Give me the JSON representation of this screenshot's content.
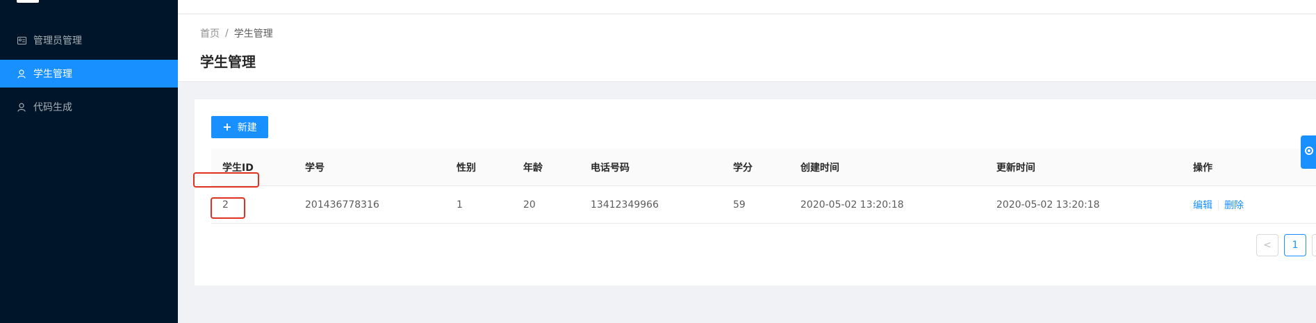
{
  "sidebar": {
    "items": [
      {
        "label": "管理员管理",
        "icon": "id-card-icon",
        "active": false
      },
      {
        "label": "学生管理",
        "icon": "user-icon",
        "active": true
      },
      {
        "label": "代码生成",
        "icon": "user-icon",
        "active": false
      }
    ]
  },
  "breadcrumb": {
    "home": "首页",
    "separator": "/",
    "current": "学生管理"
  },
  "page": {
    "title": "学生管理"
  },
  "toolbar": {
    "new_label": "新建"
  },
  "table": {
    "columns": [
      "学生ID",
      "学号",
      "性别",
      "年龄",
      "电话号码",
      "学分",
      "创建时间",
      "更新时间",
      "操作"
    ],
    "rows": [
      {
        "id": "2",
        "student_no": "201436778316",
        "gender": "1",
        "age": "20",
        "phone": "13412349966",
        "credits": "59",
        "created": "2020-05-02 13:20:18",
        "updated": "2020-05-02 13:20:18",
        "actions": {
          "edit": "编辑",
          "delete": "删除"
        }
      }
    ]
  },
  "pagination": {
    "prev": "<",
    "current": "1",
    "next": ">"
  },
  "colors": {
    "primary": "#1890ff",
    "sider": "#001529",
    "highlight": "#e0301e"
  }
}
